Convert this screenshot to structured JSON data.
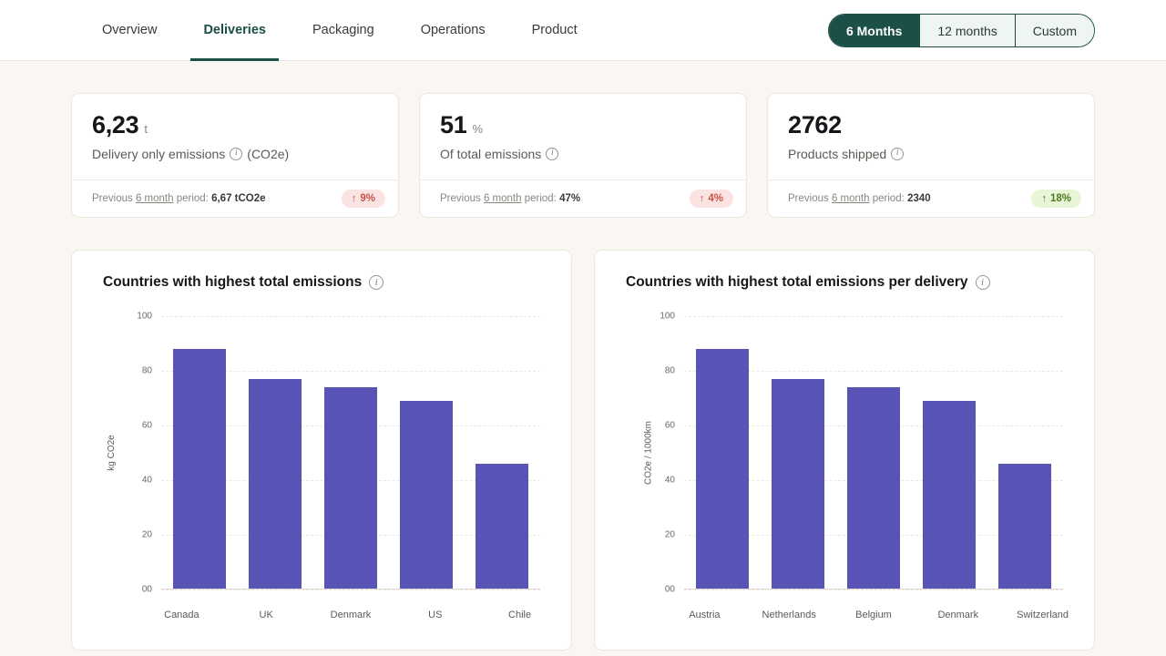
{
  "header": {
    "tabs": [
      {
        "label": "Overview",
        "active": false
      },
      {
        "label": "Deliveries",
        "active": true
      },
      {
        "label": "Packaging",
        "active": false
      },
      {
        "label": "Operations",
        "active": false
      },
      {
        "label": "Product",
        "active": false
      }
    ],
    "period_selector": {
      "options": [
        "6 Months",
        "12 months",
        "Custom"
      ],
      "selected": "6 Months"
    }
  },
  "kpis": [
    {
      "value": "6,23",
      "unit": "t",
      "label": "Delivery only emissions",
      "label_suffix": "(CO2e)",
      "info_icon": "info-icon",
      "previous_prefix": "Previous",
      "previous_period": "6 month",
      "previous_mid": "period:",
      "previous_value": "6,67 tCO2e",
      "delta": "9%",
      "delta_arrow": "↑",
      "delta_direction": "up",
      "delta_tone": "red"
    },
    {
      "value": "51",
      "unit": "%",
      "label": "Of total emissions",
      "label_suffix": "",
      "info_icon": "info-icon",
      "previous_prefix": "Previous",
      "previous_period": "6 month",
      "previous_mid": "period:",
      "previous_value": "47%",
      "delta": "4%",
      "delta_arrow": "↑",
      "delta_direction": "up",
      "delta_tone": "red"
    },
    {
      "value": "2762",
      "unit": "",
      "label": "Products shipped",
      "label_suffix": "",
      "info_icon": "info-icon",
      "previous_prefix": "Previous",
      "previous_period": "6 month",
      "previous_mid": "period:",
      "previous_value": "2340",
      "delta": "18%",
      "delta_arrow": "↑",
      "delta_direction": "up",
      "delta_tone": "green"
    }
  ],
  "colors": {
    "bar": "#5854b6",
    "accent_green": "#1b4f47",
    "badge_red_bg": "#fbe3e2",
    "badge_red_text": "#c7524a",
    "badge_green_bg": "#e9f5d7",
    "badge_green_text": "#4f7a1f",
    "page_bg": "#faf6f1"
  },
  "chart_data": [
    {
      "type": "bar",
      "title": "Countries with highest total emissions",
      "info_icon": "info-icon",
      "categories": [
        "Canada",
        "UK",
        "Denmark",
        "US",
        "Chile"
      ],
      "values": [
        88,
        77,
        74,
        69,
        46
      ],
      "xlabel": "",
      "ylabel": "kg CO2e",
      "ylim": [
        0,
        100
      ],
      "yticks": [
        "100",
        "80",
        "60",
        "40",
        "20",
        "00"
      ],
      "ytick_values": [
        100,
        80,
        60,
        40,
        20,
        0
      ],
      "grid": true,
      "legend": "none"
    },
    {
      "type": "bar",
      "title": "Countries with highest total emissions per delivery",
      "info_icon": "info-icon",
      "categories": [
        "Austria",
        "Netherlands",
        "Belgium",
        "Denmark",
        "Switzerland"
      ],
      "values": [
        88,
        77,
        74,
        69,
        46
      ],
      "xlabel": "",
      "ylabel": "CO2e / 1000km",
      "ylim": [
        0,
        100
      ],
      "yticks": [
        "100",
        "80",
        "60",
        "40",
        "20",
        "00"
      ],
      "ytick_values": [
        100,
        80,
        60,
        40,
        20,
        0
      ],
      "grid": true,
      "legend": "none"
    }
  ]
}
